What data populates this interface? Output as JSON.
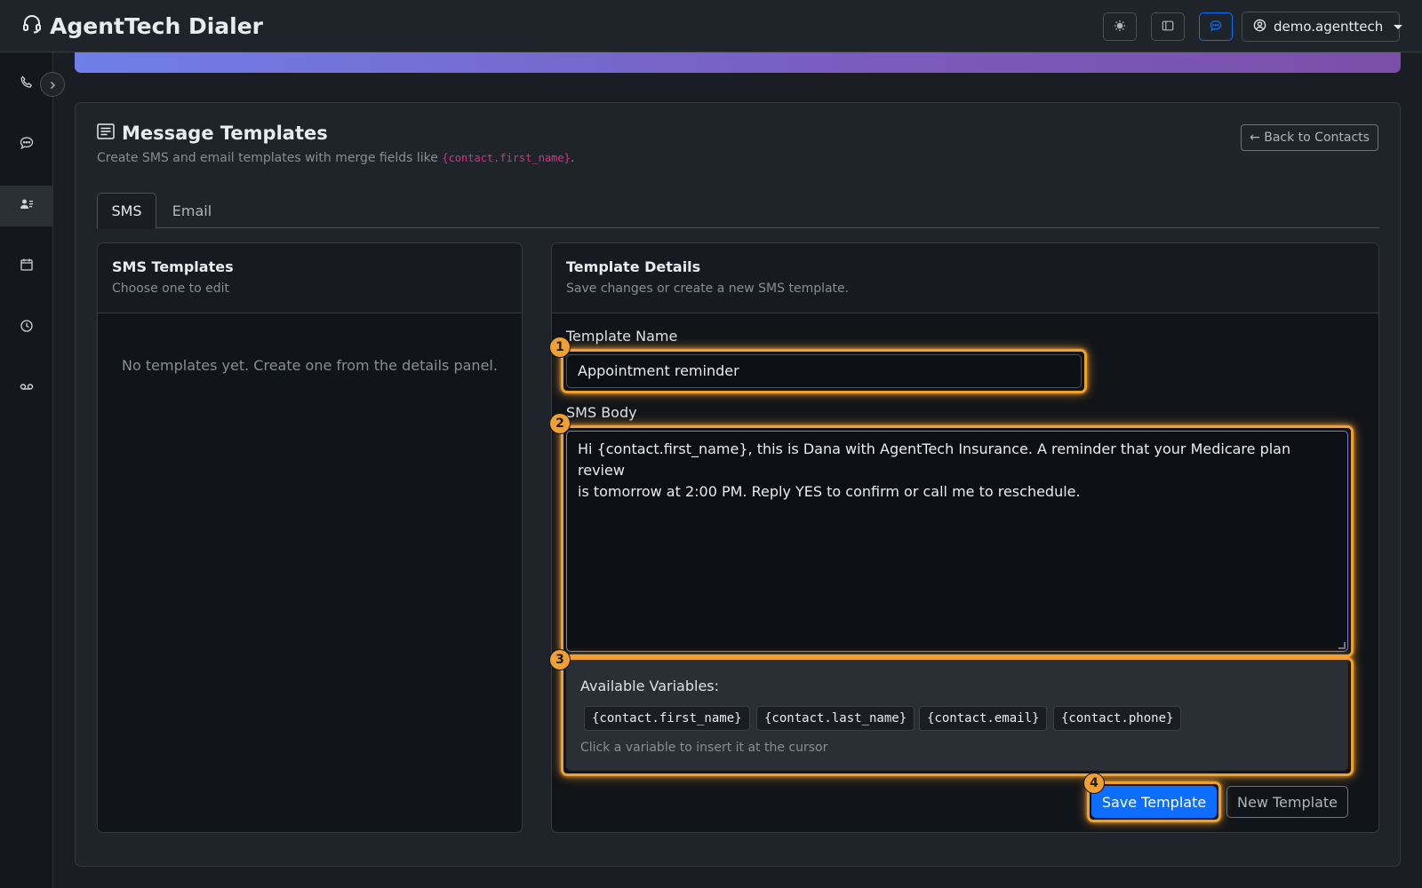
{
  "app": {
    "title": "AgentTech Dialer"
  },
  "navbar": {
    "icons": [
      "sun-icon",
      "sidebar-toggle-icon",
      "chat-icon"
    ],
    "user": "demo.agenttech"
  },
  "sidebar": {
    "items": [
      {
        "icon": "phone-icon"
      },
      {
        "icon": "message-icon"
      },
      {
        "icon": "contacts-icon",
        "active": true
      },
      {
        "icon": "calendar-icon"
      },
      {
        "icon": "clock-icon"
      },
      {
        "icon": "voicemail-icon"
      }
    ]
  },
  "page": {
    "title": "Message Templates",
    "subtitle_prefix": "Create SMS and email templates with merge fields like ",
    "subtitle_code": "{contact.first_name}",
    "subtitle_suffix": ".",
    "back_button": "← Back to Contacts",
    "tabs": [
      {
        "label": "SMS",
        "active": true
      },
      {
        "label": "Email",
        "active": false
      }
    ]
  },
  "list_panel": {
    "title": "SMS Templates",
    "subtitle": "Choose one to edit",
    "empty_message": "No templates yet. Create one from the details panel."
  },
  "details_panel": {
    "title": "Template Details",
    "subtitle": "Save changes or create a new SMS template.",
    "name_label": "Template Name",
    "name_value": "Appointment reminder",
    "body_label": "SMS Body",
    "body_value": "Hi {contact.first_name}, this is Dana with AgentTech Insurance. A reminder that your Medicare plan review\nis tomorrow at 2:00 PM. Reply YES to confirm or call me to reschedule.",
    "variables_title": "Available Variables:",
    "variables": [
      "{contact.first_name}",
      "{contact.last_name}",
      "{contact.email}",
      "{contact.phone}"
    ],
    "variables_hint": "Click a variable to insert it at the cursor",
    "save_button": "Save Template",
    "new_button": "New Template"
  },
  "annotations": [
    "1",
    "2",
    "3",
    "4"
  ],
  "colors": {
    "accent": "#0d6efd",
    "highlight": "#f0a030",
    "code": "#d63384",
    "banner_start": "#6f7fe8",
    "banner_end": "#7b4fa9"
  }
}
